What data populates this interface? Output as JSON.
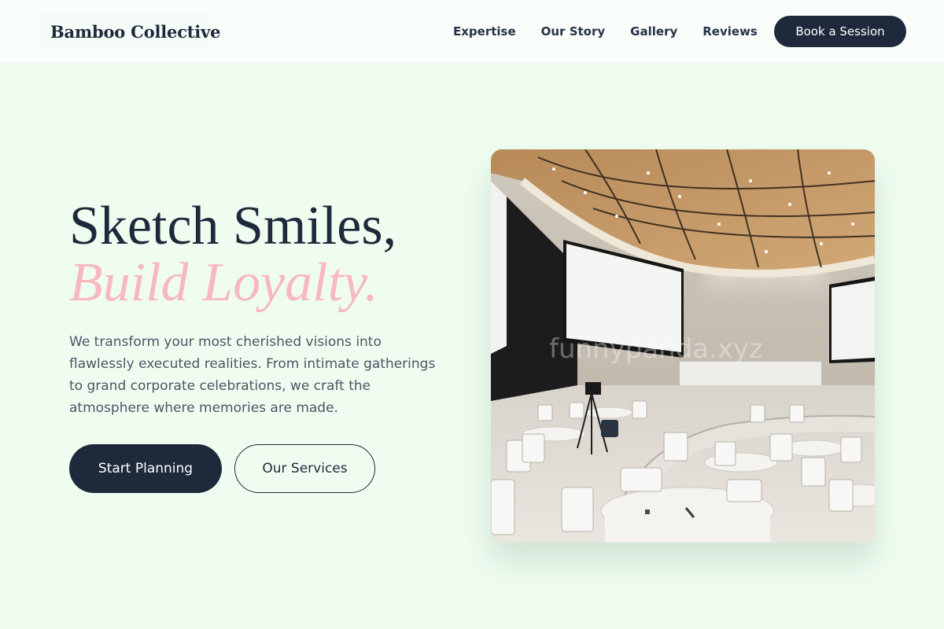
{
  "header": {
    "logo": "Bamboo Collective",
    "nav": [
      "Expertise",
      "Our Story",
      "Gallery",
      "Reviews"
    ],
    "cta": "Book a Session"
  },
  "hero": {
    "title_line1": "Sketch Smiles,",
    "title_line2": "Build Loyalty.",
    "description": "We transform your most cherished visions into flawlessly executed realities. From intimate gatherings to grand corporate celebrations, we craft the atmosphere where memories are made.",
    "primary_button": "Start Planning",
    "secondary_button": "Our Services",
    "image": {
      "subject": "conference-hall-photo",
      "watermark": "funnypanda.xyz"
    }
  },
  "colors": {
    "background": "#effdf1",
    "header_bg": "#fafefb",
    "navy": "#1e293b",
    "accent_pink": "#f8b8c0",
    "body_text": "#4b5563"
  }
}
